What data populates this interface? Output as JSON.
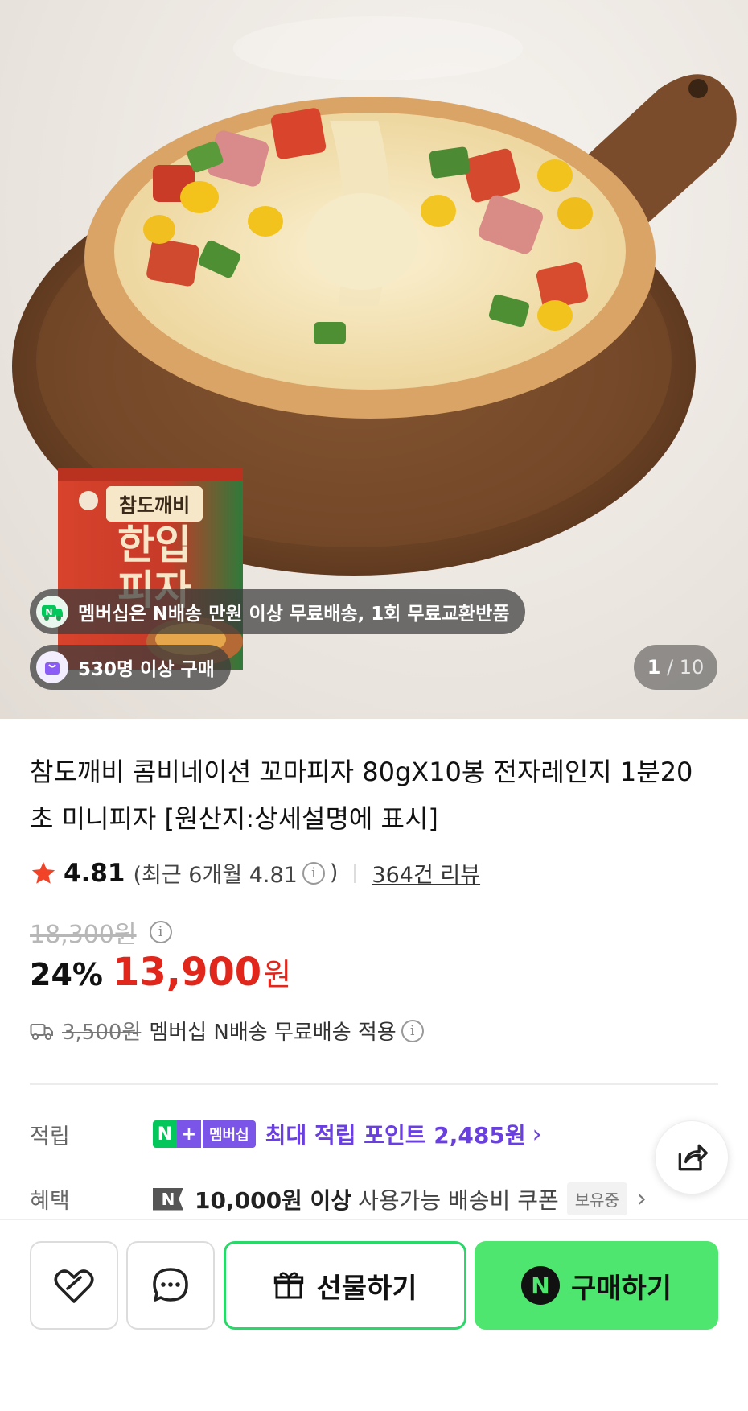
{
  "hero": {
    "package_brand": "참도깨비",
    "package_name_line1": "한입",
    "package_name_line2": "피자",
    "membership_banner": "멤버십은 N배송 만원 이상 무료배송, 1회 무료교환반품",
    "buyers_badge": "530명 이상 구매",
    "counter_current": "1",
    "counter_sep": " / ",
    "counter_total": "10"
  },
  "product": {
    "title": "참도깨비 콤비네이션 꼬마피자 80gX10봉 전자레인지 1분20초 미니피자 [원산지:상세설명에 표시]",
    "rating": "4.81",
    "recent_rating_prefix": "(최근 6개월 4.81",
    "recent_rating_suffix": ")",
    "review_count": "364건 리뷰",
    "original_price": "18,300원",
    "discount": "24%",
    "sale_price": "13,900",
    "currency": "원",
    "shipping_original": "3,500원",
    "shipping_note": "멤버십 N배송 무료배송 적용"
  },
  "benefits": {
    "points_label": "적립",
    "badge_n": "N",
    "badge_plus": "+",
    "badge_member": "멤버십",
    "points_text": "최대 적립 포인트 2,485원",
    "benefit_label": "혜택",
    "coupon_n": "N",
    "coupon_bold": "10,000원 이상",
    "coupon_text": "사용가능 배송비 쿠폰",
    "coupon_status": "보유중"
  },
  "actions": {
    "gift_label": "선물하기",
    "buy_logo": "N",
    "buy_label": "구매하기"
  },
  "colors": {
    "sale_red": "#e1261c",
    "naver_green": "#4ee66f",
    "membership_purple": "#7b55e8"
  }
}
